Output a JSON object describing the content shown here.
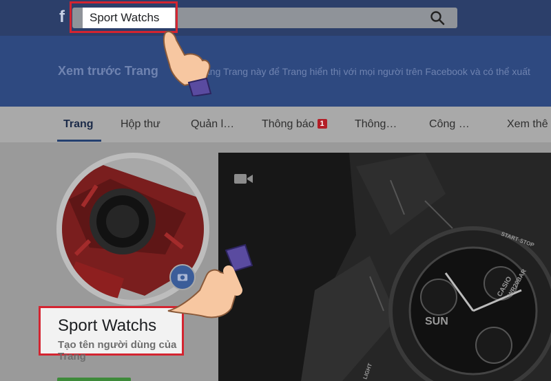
{
  "topbar": {
    "logo": "f",
    "search": {
      "value": "Sport Watchs",
      "icon": "search-icon"
    }
  },
  "preview": {
    "title": "Xem trước Trang",
    "description": "ăng Trang này để Trang hiển thị với mọi người trên Facebook và có thể xuất"
  },
  "tabs": [
    {
      "label": "Trang",
      "active": true
    },
    {
      "label": "Hộp thư"
    },
    {
      "label": "Quản l…"
    },
    {
      "label": "Thông báo",
      "badge": "1"
    },
    {
      "label": "Thông…"
    },
    {
      "label": "Công …"
    },
    {
      "label": "Xem thê"
    }
  ],
  "profile": {
    "name": "Sport Watchs",
    "username_prompt": "Tạo tên người dùng của Trang"
  },
  "cover": {
    "icon": "video-icon",
    "watch_texts": [
      "SUN",
      "CASIO",
      "WR20BAR",
      "START·STOP",
      "LIGHT"
    ]
  },
  "colors": {
    "highlight": "#d42430",
    "topbar": "#2c3f6a",
    "band": "#2e4980",
    "accent": "#24406f"
  }
}
